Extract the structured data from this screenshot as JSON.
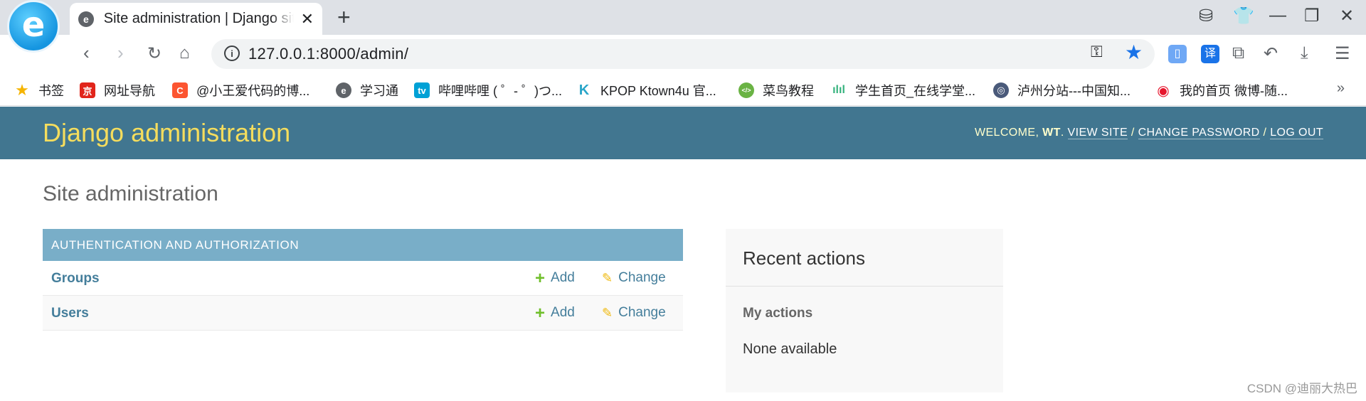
{
  "browser": {
    "tab_title": "Site administration | Django site admin",
    "url": "127.0.0.1:8000/admin/",
    "bookmarks": [
      {
        "label": "书签",
        "icon": "star-icon",
        "color": "#f5b400"
      },
      {
        "label": "网址导航",
        "icon": "jd-icon",
        "color": "#e1251b"
      },
      {
        "label": "@小王爱代码的博...",
        "icon": "csdn-icon",
        "color": "#fc5531"
      },
      {
        "label": "学习通",
        "icon": "xuexitong-icon",
        "color": "#5f6368"
      },
      {
        "label": "哔哩哔哩 ( ゜- ゜)つ...",
        "icon": "bilibili-icon",
        "color": "#00a1d6"
      },
      {
        "label": "KPOP Ktown4u 官...",
        "icon": "ktown-icon",
        "color": "#2aa6c9"
      },
      {
        "label": "菜鸟教程",
        "icon": "runoob-icon",
        "color": "#6ab344"
      },
      {
        "label": "学生首页_在线学堂...",
        "icon": "audio-wave-icon",
        "color": "#36b37e"
      },
      {
        "label": "泸州分站---中国知...",
        "icon": "cnki-icon",
        "color": "#4a5a7a"
      },
      {
        "label": "我的首页 微博-随...",
        "icon": "weibo-icon",
        "color": "#e6162d"
      }
    ],
    "bookmarks_more": "»"
  },
  "admin": {
    "brand": "Django administration",
    "welcome": "WELCOME, ",
    "username": "WT",
    "view_site": "VIEW SITE",
    "change_password": "CHANGE PASSWORD",
    "log_out": "LOG OUT",
    "page_title": "Site administration",
    "app_caption": "AUTHENTICATION AND AUTHORIZATION",
    "models": [
      {
        "name": "Groups",
        "add": "Add",
        "change": "Change"
      },
      {
        "name": "Users",
        "add": "Add",
        "change": "Change"
      }
    ],
    "recent_title": "Recent actions",
    "my_actions": "My actions",
    "none_available": "None available"
  },
  "watermark": "CSDN @迪丽大热巴",
  "colors": {
    "header_bg": "#417690",
    "brand": "#f5dd5d",
    "caption_bg": "#79aec8",
    "link": "#447e9b",
    "add_green": "#70bf2b",
    "change_yellow": "#efb80b"
  }
}
